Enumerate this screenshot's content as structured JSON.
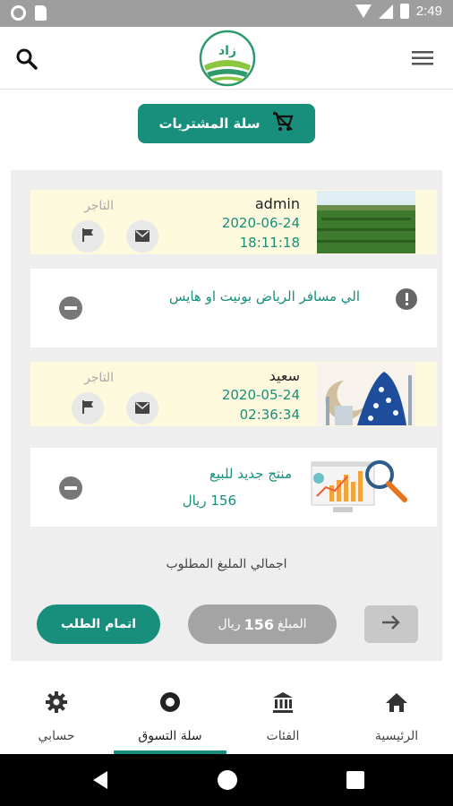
{
  "status_bar": {
    "time": "2:49"
  },
  "header": {
    "cart_title": "سلة المشتريات"
  },
  "orders": [
    {
      "merchant": {
        "name": "admin",
        "date": "2020-06-24",
        "time": "18:11:18",
        "label": "التاجر"
      },
      "item": {
        "text": "الي مسافر الرياض بونيت او هايس",
        "price": ""
      }
    },
    {
      "merchant": {
        "name": "سعيد",
        "date": "2020-05-24",
        "time": "02:36:34",
        "label": "التاجر"
      },
      "item": {
        "text": "منتج جديد للبيع",
        "price": "156 ريال"
      }
    }
  ],
  "summary": {
    "total_label": "اجمالي المليغ المطلوب",
    "amount_prefix": "المبلغ",
    "amount_value": "156",
    "amount_currency": "ريال",
    "complete_label": "اتمام الطلب"
  },
  "bottom_nav": [
    {
      "label": "حسابي",
      "icon": "gear-icon",
      "active": false
    },
    {
      "label": "سلة التسوق",
      "icon": "cart-circle-icon",
      "active": true
    },
    {
      "label": "الفئات",
      "icon": "bank-icon",
      "active": false
    },
    {
      "label": "الرئيسية",
      "icon": "home-icon",
      "active": false
    }
  ],
  "colors": {
    "accent": "#178f7c",
    "merchant_bg": "#fdf9dd",
    "panel_bg": "#eeeeee"
  }
}
